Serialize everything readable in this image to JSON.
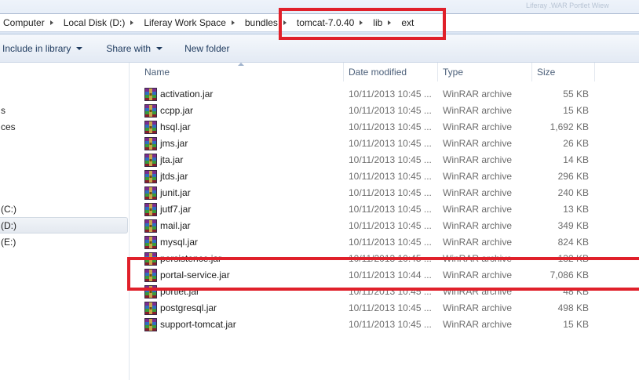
{
  "watermark": "Liferay .WAR Portlet Wiew",
  "breadcrumb": [
    "Computer",
    "Local Disk (D:)",
    "Liferay Work Space",
    "bundles",
    "tomcat-7.0.40",
    "lib",
    "ext"
  ],
  "toolbar": {
    "include_label": "Include in library",
    "share_label": "Share with",
    "new_folder_label": "New folder"
  },
  "nav": {
    "items": [
      "s",
      "ces",
      "(C:)",
      "(D:)",
      "(E:)"
    ]
  },
  "columns": {
    "name": "Name",
    "date": "Date modified",
    "type": "Type",
    "size": "Size"
  },
  "files": [
    {
      "name": "activation.jar",
      "date": "10/11/2013 10:45 ...",
      "type": "WinRAR archive",
      "size": "55 KB"
    },
    {
      "name": "ccpp.jar",
      "date": "10/11/2013 10:45 ...",
      "type": "WinRAR archive",
      "size": "15 KB"
    },
    {
      "name": "hsql.jar",
      "date": "10/11/2013 10:45 ...",
      "type": "WinRAR archive",
      "size": "1,692 KB"
    },
    {
      "name": "jms.jar",
      "date": "10/11/2013 10:45 ...",
      "type": "WinRAR archive",
      "size": "26 KB"
    },
    {
      "name": "jta.jar",
      "date": "10/11/2013 10:45 ...",
      "type": "WinRAR archive",
      "size": "14 KB"
    },
    {
      "name": "jtds.jar",
      "date": "10/11/2013 10:45 ...",
      "type": "WinRAR archive",
      "size": "296 KB"
    },
    {
      "name": "junit.jar",
      "date": "10/11/2013 10:45 ...",
      "type": "WinRAR archive",
      "size": "240 KB"
    },
    {
      "name": "jutf7.jar",
      "date": "10/11/2013 10:45 ...",
      "type": "WinRAR archive",
      "size": "13 KB"
    },
    {
      "name": "mail.jar",
      "date": "10/11/2013 10:45 ...",
      "type": "WinRAR archive",
      "size": "349 KB"
    },
    {
      "name": "mysql.jar",
      "date": "10/11/2013 10:45 ...",
      "type": "WinRAR archive",
      "size": "824 KB"
    },
    {
      "name": "persistence.jar",
      "date": "10/11/2013 10:45 ...",
      "type": "WinRAR archive",
      "size": "132 KB"
    },
    {
      "name": "portal-service.jar",
      "date": "10/11/2013 10:44 ...",
      "type": "WinRAR archive",
      "size": "7,086 KB"
    },
    {
      "name": "portlet.jar",
      "date": "10/11/2013 10:45 ...",
      "type": "WinRAR archive",
      "size": "48 KB"
    },
    {
      "name": "postgresql.jar",
      "date": "10/11/2013 10:45 ...",
      "type": "WinRAR archive",
      "size": "498 KB"
    },
    {
      "name": "support-tomcat.jar",
      "date": "10/11/2013 10:45 ...",
      "type": "WinRAR archive",
      "size": "15 KB"
    }
  ],
  "colors": {
    "annotation": "#e0202a",
    "header_text": "#4c607a",
    "secondary_text": "#6d6d6d"
  }
}
